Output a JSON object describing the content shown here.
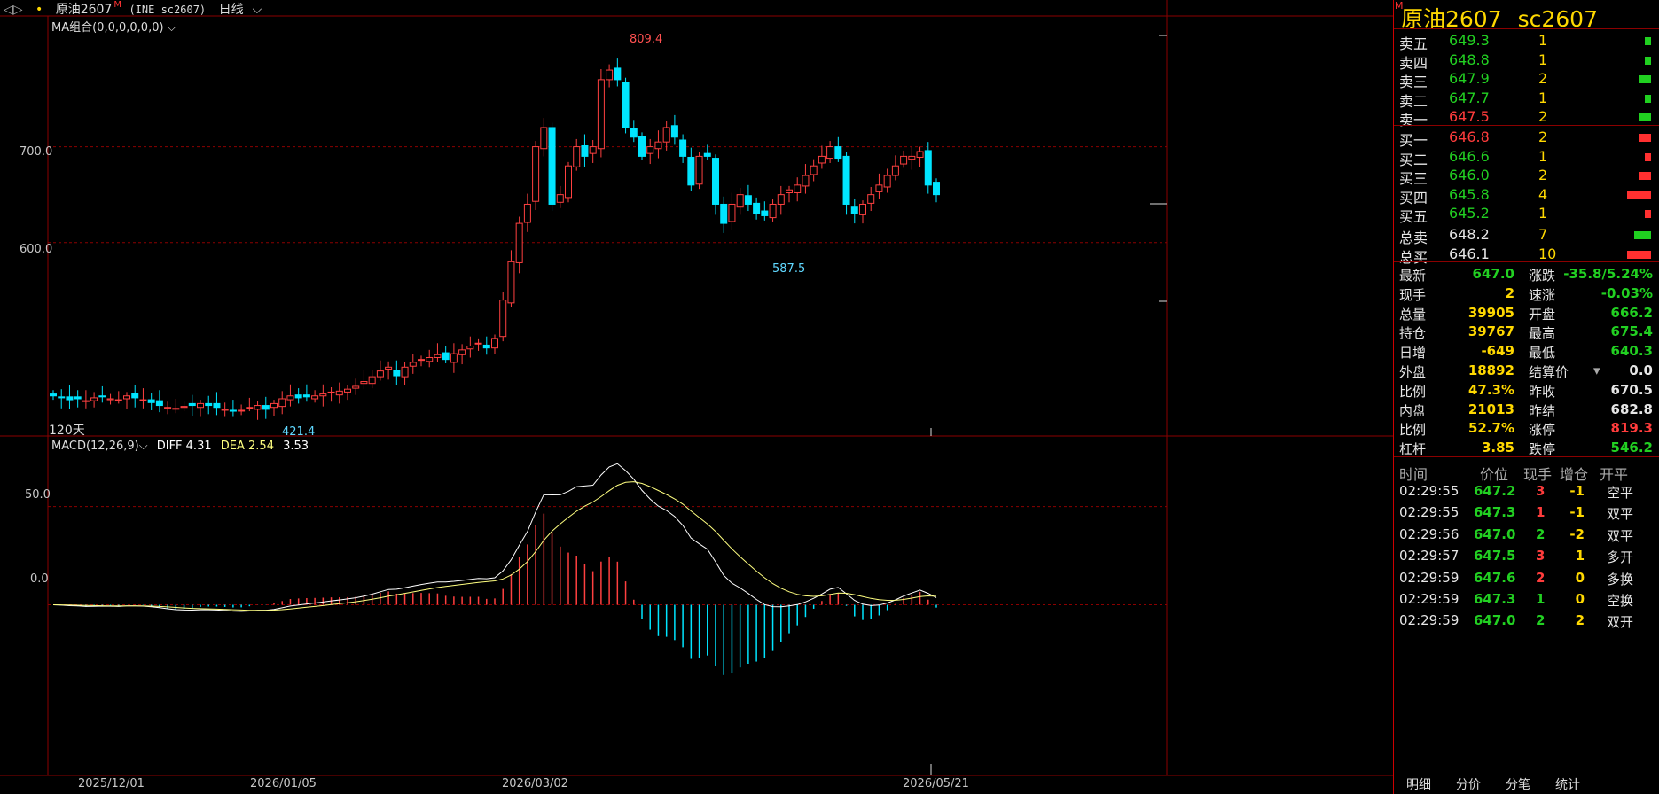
{
  "header": {
    "symbol": "原油2607",
    "code_label": "(INE sc2607)",
    "period": "日线",
    "ma_label": "MA组合(0,0,0,0,0,0)",
    "days_label": "120天"
  },
  "macd": {
    "label": "MACD(12,26,9)",
    "diff": "DIFF 4.31",
    "dea": "DEA 2.54",
    "val": "3.53"
  },
  "axes": {
    "price_ticks": [
      "700.0",
      "600.0"
    ],
    "macd_ticks": [
      "50.0",
      "0.0"
    ],
    "dates": [
      "2025/12/01",
      "2026/01/05",
      "2026/03/02",
      "2026/05/21"
    ]
  },
  "annotations": {
    "high": "809.4",
    "low": "421.4",
    "mid_low": "587.5"
  },
  "colors": {
    "up": "#ff4040",
    "down": "#00e5ff",
    "diff_line": "#ffffff",
    "dea_line": "#ffff80",
    "grid": "#8b0000"
  },
  "chart_data": {
    "type": "candlestick",
    "title": "原油2607 (INE sc2607) 日线",
    "ohlc_closes_approx": [
      440,
      438,
      436,
      437,
      435,
      438,
      439,
      437,
      436,
      440,
      438,
      436,
      433,
      430,
      428,
      427,
      429,
      430,
      432,
      430,
      428,
      426,
      424,
      425,
      428,
      430,
      426,
      432,
      437,
      440,
      438,
      439,
      440,
      442,
      444,
      445,
      447,
      450,
      455,
      460,
      466,
      470,
      461,
      470,
      475,
      478,
      480,
      483,
      478,
      484,
      488,
      492,
      495,
      490,
      500,
      540,
      580,
      620,
      640,
      700,
      720,
      640,
      650,
      680,
      700,
      690,
      700,
      770,
      780,
      770,
      720,
      710,
      690,
      700,
      705,
      720,
      710,
      690,
      660,
      690,
      690,
      640,
      620,
      640,
      650,
      640,
      630,
      628,
      640,
      650,
      655,
      660,
      670,
      680,
      690,
      700,
      688,
      640,
      630,
      640,
      650,
      660,
      670,
      680,
      690,
      690,
      695,
      660,
      650
    ],
    "price_ylim": [
      400,
      830
    ],
    "macd_ylim": [
      -80,
      80
    ]
  },
  "panel": {
    "title_name": "原油2607",
    "title_code": "sc2607",
    "asks": [
      {
        "label": "卖五",
        "price": "649.3",
        "vol": "1",
        "bar": 0.2
      },
      {
        "label": "卖四",
        "price": "648.8",
        "vol": "1",
        "bar": 0.2
      },
      {
        "label": "卖三",
        "price": "647.9",
        "vol": "2",
        "bar": 0.4
      },
      {
        "label": "卖二",
        "price": "647.7",
        "vol": "1",
        "bar": 0.2
      },
      {
        "label": "卖一",
        "price": "647.5",
        "vol": "2",
        "bar": 0.4
      }
    ],
    "bids": [
      {
        "label": "买一",
        "price": "646.8",
        "vol": "2",
        "bar": 0.4
      },
      {
        "label": "买二",
        "price": "646.6",
        "vol": "1",
        "bar": 0.2
      },
      {
        "label": "买三",
        "price": "646.0",
        "vol": "2",
        "bar": 0.4
      },
      {
        "label": "买四",
        "price": "645.8",
        "vol": "4",
        "bar": 0.8
      },
      {
        "label": "买五",
        "price": "645.2",
        "vol": "1",
        "bar": 0.2
      }
    ],
    "totals": [
      {
        "label": "总卖",
        "price": "648.2",
        "vol": "7",
        "bar": 0.55,
        "color": "green"
      },
      {
        "label": "总买",
        "price": "646.1",
        "vol": "10",
        "bar": 0.8,
        "color": "red"
      }
    ],
    "quotes": [
      {
        "l1": "最新",
        "v1": "647.0",
        "c1": "green",
        "l2": "涨跌",
        "v2": "-35.8/5.24%",
        "c2": "green"
      },
      {
        "l1": "现手",
        "v1": "2",
        "c1": "yellow",
        "l2": "速涨",
        "v2": "-0.03%",
        "c2": "green"
      },
      {
        "l1": "总量",
        "v1": "39905",
        "c1": "yellow",
        "l2": "开盘",
        "v2": "666.2",
        "c2": "green"
      },
      {
        "l1": "持仓",
        "v1": "39767",
        "c1": "yellow",
        "l2": "最高",
        "v2": "675.4",
        "c2": "green"
      },
      {
        "l1": "日增",
        "v1": "-649",
        "c1": "yellow",
        "l2": "最低",
        "v2": "640.3",
        "c2": "green"
      },
      {
        "l1": "外盘",
        "v1": "18892",
        "c1": "yellow",
        "l2": "结算价",
        "v2": "0.0",
        "c2": "white"
      },
      {
        "l1": "比例",
        "v1": "47.3%",
        "c1": "yellow",
        "l2": "昨收",
        "v2": "670.5",
        "c2": "white"
      },
      {
        "l1": "内盘",
        "v1": "21013",
        "c1": "yellow",
        "l2": "昨结",
        "v2": "682.8",
        "c2": "white"
      },
      {
        "l1": "比例",
        "v1": "52.7%",
        "c1": "yellow",
        "l2": "涨停",
        "v2": "819.3",
        "c2": "red"
      },
      {
        "l1": "杠杆",
        "v1": "3.85",
        "c1": "yellow",
        "l2": "跌停",
        "v2": "546.2",
        "c2": "green"
      }
    ],
    "ticks_header": [
      "时间",
      "价位",
      "现手",
      "增仓",
      "开平"
    ],
    "ticks": [
      {
        "t": "02:29:55",
        "p": "647.2",
        "v": "3",
        "vc": "red",
        "d": "-1",
        "k": "空平"
      },
      {
        "t": "02:29:55",
        "p": "647.3",
        "v": "1",
        "vc": "red",
        "d": "-1",
        "k": "双平"
      },
      {
        "t": "02:29:56",
        "p": "647.0",
        "v": "2",
        "vc": "green",
        "d": "-2",
        "k": "双平"
      },
      {
        "t": "02:29:57",
        "p": "647.5",
        "v": "3",
        "vc": "red",
        "d": "1",
        "k": "多开"
      },
      {
        "t": "02:29:59",
        "p": "647.6",
        "v": "2",
        "vc": "red",
        "d": "0",
        "k": "多换"
      },
      {
        "t": "02:29:59",
        "p": "647.3",
        "v": "1",
        "vc": "green",
        "d": "0",
        "k": "空换"
      },
      {
        "t": "02:29:59",
        "p": "647.0",
        "v": "2",
        "vc": "green",
        "d": "2",
        "k": "双开"
      }
    ],
    "tabs": [
      "明细",
      "分价",
      "分笔",
      "统计"
    ]
  }
}
